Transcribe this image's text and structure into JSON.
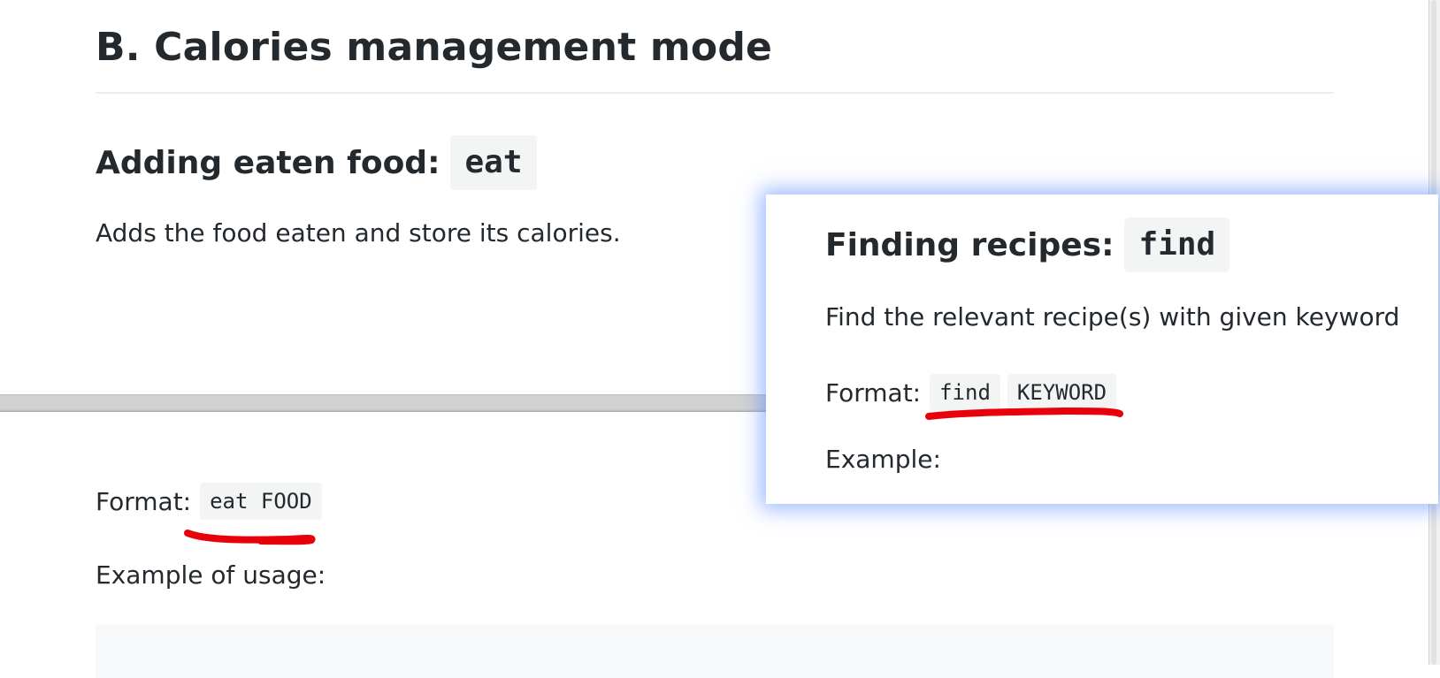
{
  "section": {
    "title": "B. Calories management mode"
  },
  "eat": {
    "heading_text": "Adding eaten food:",
    "heading_code": "eat",
    "description": "Adds the food eaten and store its calories.",
    "format_label": "Format:",
    "format_code": "eat FOOD",
    "example_label": "Example of usage:"
  },
  "find_popup": {
    "heading_text": "Finding recipes:",
    "heading_code": "find",
    "description": "Find the relevant recipe(s) with given keyword",
    "format_label": "Format:",
    "format_code_1": "find",
    "format_code_2": "KEYWORD",
    "example_label": "Example:"
  },
  "colors": {
    "annotation": "#e8000b",
    "popup_glow": "#4b82ff",
    "code_bg": "#f3f4f4",
    "text": "#24292e"
  }
}
